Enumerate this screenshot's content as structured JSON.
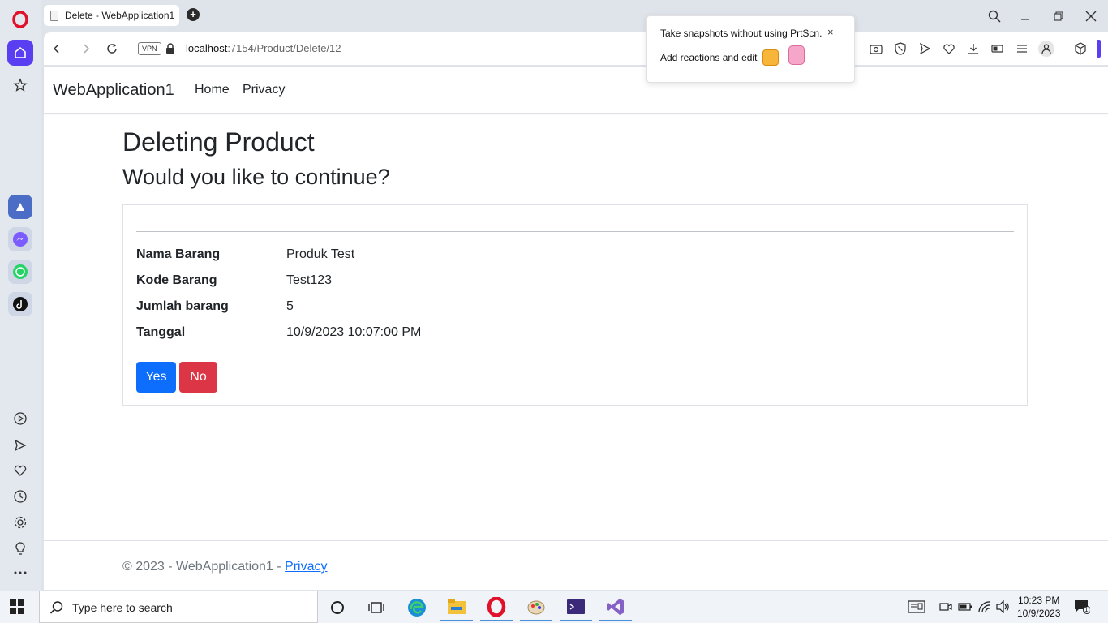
{
  "browser": {
    "tab_title": "Delete - WebApplication1",
    "new_tab_symbol": "+",
    "vpn_label": "VPN",
    "url_host": "localhost",
    "url_path": ":7154/Product/Delete/12"
  },
  "popup": {
    "line1": "Take snapshots without using PrtScn.",
    "line2": "Add reactions and edit",
    "close_symbol": "×"
  },
  "site": {
    "brand": "WebApplication1",
    "nav": [
      "Home",
      "Privacy"
    ]
  },
  "main": {
    "title": "Deleting Product",
    "subtitle": "Would you like to continue?",
    "fields": [
      {
        "label": "Nama Barang",
        "value": "Produk Test"
      },
      {
        "label": "Kode Barang",
        "value": "Test123"
      },
      {
        "label": "Jumlah barang",
        "value": "5"
      },
      {
        "label": "Tanggal",
        "value": "10/9/2023 10:07:00 PM"
      }
    ],
    "yes_label": "Yes",
    "no_label": "No"
  },
  "footer": {
    "text": "© 2023 - WebApplication1 - ",
    "link": "Privacy"
  },
  "taskbar": {
    "search_placeholder": "Type here to search",
    "time": "10:23 PM",
    "date": "10/9/2023",
    "notification_count": "1"
  },
  "colors": {
    "primary": "#0d6efd",
    "danger": "#dc3545",
    "opera_home": "#5a3ef2"
  }
}
